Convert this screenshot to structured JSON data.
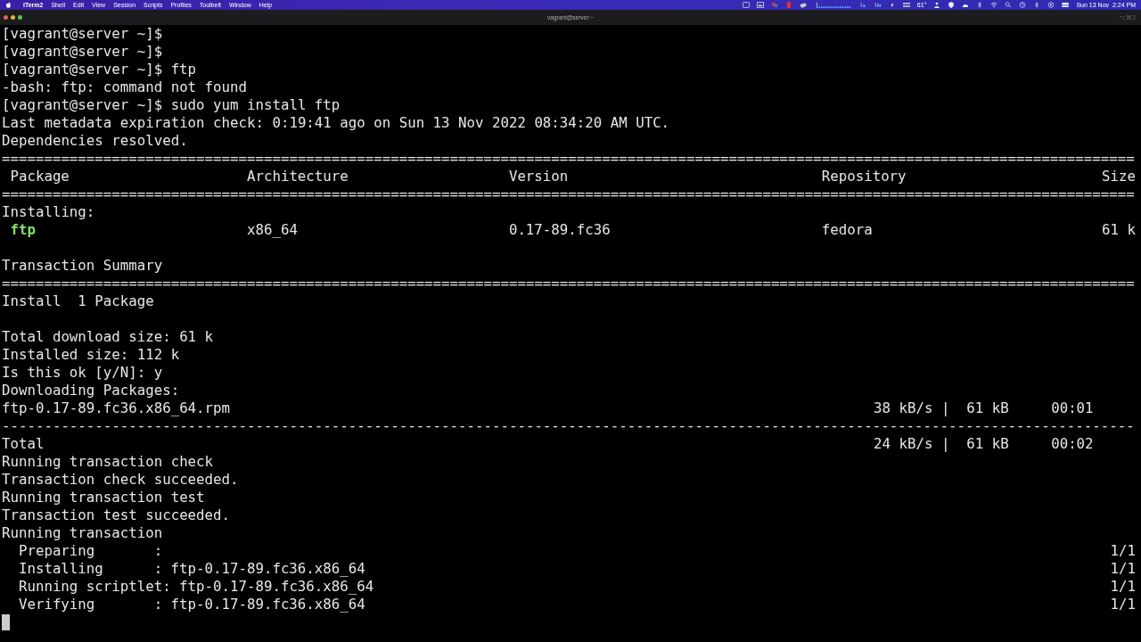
{
  "menu_bar": {
    "items": [
      {
        "label": "iTerm2",
        "kind": "app"
      },
      {
        "label": "Shell",
        "kind": "menu"
      },
      {
        "label": "Edit",
        "kind": "menu"
      },
      {
        "label": "View",
        "kind": "menu"
      },
      {
        "label": "Session",
        "kind": "menu"
      },
      {
        "label": "Scripts",
        "kind": "menu"
      },
      {
        "label": "Profiles",
        "kind": "menu"
      },
      {
        "label": "Toolbelt",
        "kind": "menu"
      },
      {
        "label": "Window",
        "kind": "menu"
      },
      {
        "label": "Help",
        "kind": "menu"
      }
    ],
    "temperature": "61°",
    "clock": "Sun 13 Nov  2:24 PM"
  },
  "window": {
    "title": "vagrant@server:~",
    "shortcut": "⌥⌘2"
  },
  "terminal": {
    "lines": [
      {
        "kind": "prompt",
        "prompt": "[vagrant@server ~]$"
      },
      {
        "kind": "prompt",
        "prompt": "[vagrant@server ~]$"
      },
      {
        "kind": "prompt",
        "prompt": "[vagrant@server ~]$",
        "command": "ftp"
      },
      {
        "kind": "text",
        "text": "-bash: ftp: command not found"
      },
      {
        "kind": "prompt",
        "prompt": "[vagrant@server ~]$",
        "command": "sudo yum install ftp"
      },
      {
        "kind": "text",
        "text": "Last metadata expiration check: 0:19:41 ago on Sun 13 Nov 2022 08:34:20 AM UTC."
      },
      {
        "kind": "text",
        "text": "Dependencies resolved."
      },
      {
        "kind": "rule",
        "text": "======================================================================================================================================"
      },
      {
        "kind": "header",
        "cells": [
          "Package",
          "Architecture",
          "Version",
          "Repository",
          "Size"
        ]
      },
      {
        "kind": "rule",
        "text": "======================================================================================================================================"
      },
      {
        "kind": "text",
        "text": "Installing:"
      },
      {
        "kind": "package",
        "cells": [
          "ftp",
          "x86_64",
          "0.17-89.fc36",
          "fedora",
          "61 k"
        ]
      },
      {
        "kind": "blank"
      },
      {
        "kind": "text",
        "text": "Transaction Summary"
      },
      {
        "kind": "rule",
        "text": "======================================================================================================================================"
      },
      {
        "kind": "text",
        "text": "Install  1 Package"
      },
      {
        "kind": "blank"
      },
      {
        "kind": "text",
        "text": "Total download size: 61 k"
      },
      {
        "kind": "text",
        "text": "Installed size: 112 k"
      },
      {
        "kind": "text",
        "text": "Is this ok [y/N]: y"
      },
      {
        "kind": "text",
        "text": "Downloading Packages:"
      },
      {
        "kind": "download",
        "file": "ftp-0.17-89.fc36.x86_64.rpm",
        "speed": "38 kB/s",
        "separator": "|",
        "size": "61 kB",
        "time": "00:01"
      },
      {
        "kind": "rule",
        "text": "--------------------------------------------------------------------------------------------------------------------------------------"
      },
      {
        "kind": "download",
        "file": "Total",
        "speed": "24 kB/s",
        "separator": "|",
        "size": "61 kB",
        "time": "00:02"
      },
      {
        "kind": "text",
        "text": "Running transaction check"
      },
      {
        "kind": "text",
        "text": "Transaction check succeeded."
      },
      {
        "kind": "text",
        "text": "Running transaction test"
      },
      {
        "kind": "text",
        "text": "Transaction test succeeded."
      },
      {
        "kind": "text",
        "text": "Running transaction"
      },
      {
        "kind": "step",
        "label": "Preparing",
        "colon": ":",
        "count": "1/1"
      },
      {
        "kind": "step",
        "label": "Installing",
        "colon": ":",
        "package": "ftp-0.17-89.fc36.x86_64",
        "count": "1/1"
      },
      {
        "kind": "step",
        "label": "Running scriptlet",
        "colon": ":",
        "package": "ftp-0.17-89.fc36.x86_64",
        "count": "1/1"
      },
      {
        "kind": "step",
        "label": "Verifying",
        "colon": ":",
        "package": "ftp-0.17-89.fc36.x86_64",
        "count": "1/1"
      },
      {
        "kind": "cursor"
      }
    ]
  }
}
